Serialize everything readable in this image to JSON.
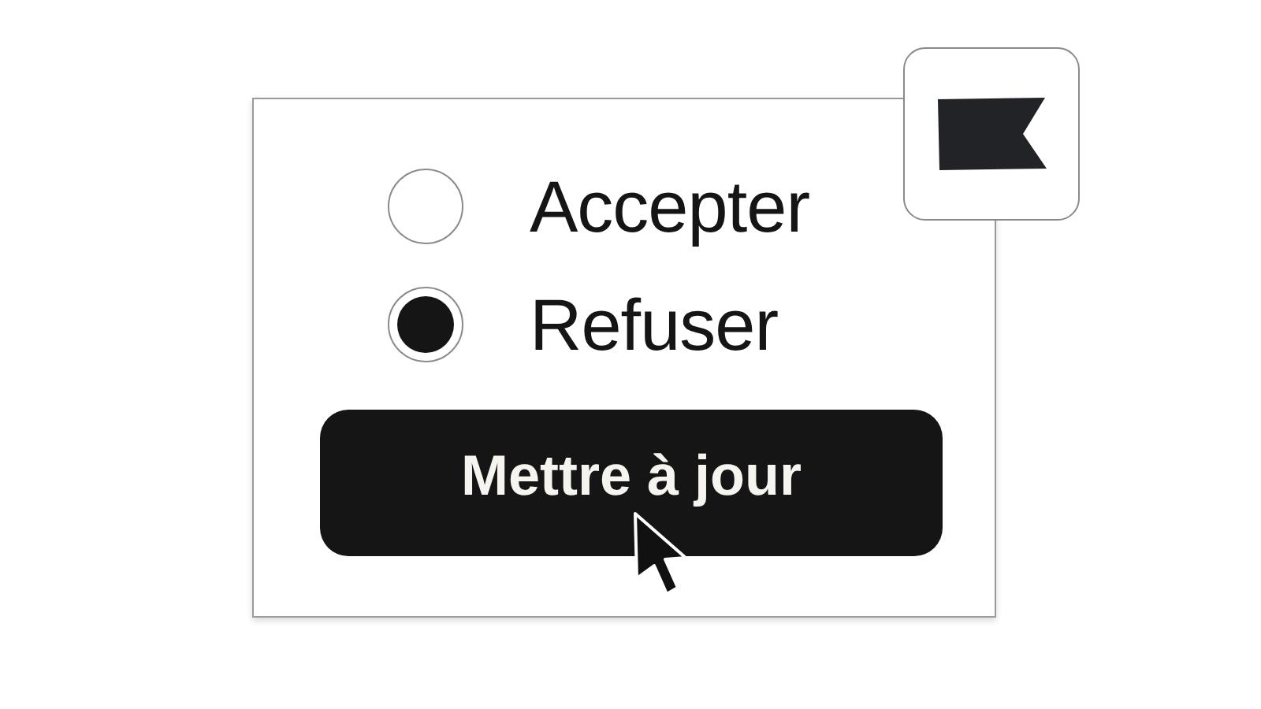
{
  "options": [
    {
      "label": "Accepter",
      "selected": false
    },
    {
      "label": "Refuser",
      "selected": true
    }
  ],
  "button": {
    "label": "Mettre à jour"
  }
}
